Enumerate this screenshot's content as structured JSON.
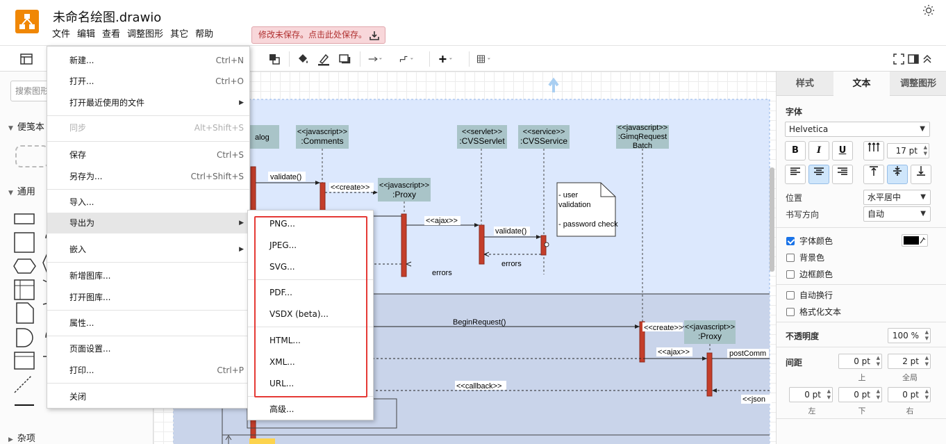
{
  "app": {
    "document_title": "未命名绘图.drawio",
    "menubar": [
      "文件",
      "编辑",
      "查看",
      "调整图形",
      "其它",
      "帮助"
    ],
    "unsaved_notice": "修改未保存。点击此处保存。"
  },
  "left_panel": {
    "search_placeholder": "搜索图形",
    "sections": {
      "scratchpad": "便笺本",
      "general": "通用",
      "misc": "杂项"
    }
  },
  "file_menu": {
    "items": [
      {
        "label": "新建...",
        "shortcut": "Ctrl+N"
      },
      {
        "label": "打开...",
        "shortcut": "Ctrl+O"
      },
      {
        "label": "打开最近使用的文件",
        "shortcut": ""
      },
      {
        "label": "同步",
        "shortcut": "Alt+Shift+S"
      },
      {
        "label": "保存",
        "shortcut": "Ctrl+S"
      },
      {
        "label": "另存为...",
        "shortcut": "Ctrl+Shift+S"
      },
      {
        "label": "导入...",
        "shortcut": ""
      },
      {
        "label": "导出为",
        "shortcut": ""
      },
      {
        "label": "嵌入",
        "shortcut": ""
      },
      {
        "label": "新增图库...",
        "shortcut": ""
      },
      {
        "label": "打开图库...",
        "shortcut": ""
      },
      {
        "label": "属性...",
        "shortcut": ""
      },
      {
        "label": "页面设置...",
        "shortcut": ""
      },
      {
        "label": "打印...",
        "shortcut": "Ctrl+P"
      },
      {
        "label": "关闭",
        "shortcut": ""
      }
    ]
  },
  "export_menu": {
    "items": [
      "PNG...",
      "JPEG...",
      "SVG...",
      "PDF...",
      "VSDX (beta)...",
      "HTML...",
      "XML...",
      "URL...",
      "高级..."
    ]
  },
  "diagram": {
    "lifelines": [
      {
        "stereotype": "",
        "name": "alog"
      },
      {
        "stereotype": "<<javascript>>",
        "name": ":Comments"
      },
      {
        "stereotype": "<<javascript>>",
        "name": ":Proxy"
      },
      {
        "stereotype": "<<servlet>>",
        "name": ":CVSServlet"
      },
      {
        "stereotype": "<<service>>",
        "name": ":CVSService"
      },
      {
        "stereotype": "<<javascript>>",
        "name": ":GimqRequest",
        "extra": "Batch"
      },
      {
        "stereotype": "<<javascript>>",
        "name": ":Proxy"
      }
    ],
    "messages": [
      "validate()",
      "<<create>>",
      "<<ajax>>",
      "validate()",
      "errors",
      "errors",
      "BeginRequest()",
      "<<create>>",
      "<<ajax>>",
      "postComm",
      "<<callback>>",
      "<<json"
    ],
    "note_lines": [
      "- user",
      "validation",
      "",
      "- password check"
    ]
  },
  "right_panel": {
    "tabs": [
      "样式",
      "文本",
      "调整图形"
    ],
    "active_tab": "文本",
    "font_label": "字体",
    "font_family": "Helvetica",
    "font_size": "17 pt",
    "position_label": "位置",
    "position_value": "水平居中",
    "direction_label": "书写方向",
    "direction_value": "自动",
    "font_color_label": "字体颜色",
    "font_color": "#000000",
    "bg_color_label": "背景色",
    "border_color_label": "边框颜色",
    "wrap_label": "自动换行",
    "formatted_label": "格式化文本",
    "opacity_label": "不透明度",
    "opacity_value": "100 %",
    "spacing_label": "间距",
    "spacing_top": "0 pt",
    "spacing_global": "2 pt",
    "spacing_left": "0 pt",
    "spacing_bottom": "0 pt",
    "spacing_right": "0 pt",
    "sub_top": "上",
    "sub_global": "全局",
    "sub_left": "左",
    "sub_bottom": "下",
    "sub_right": "右"
  },
  "colors": {
    "accent": "#f08705",
    "selection_blue": "#dce8fd",
    "activation_red": "#c43e2a",
    "lifeline_head": "#a9c4c8",
    "highlight_frame": "#e53935"
  }
}
